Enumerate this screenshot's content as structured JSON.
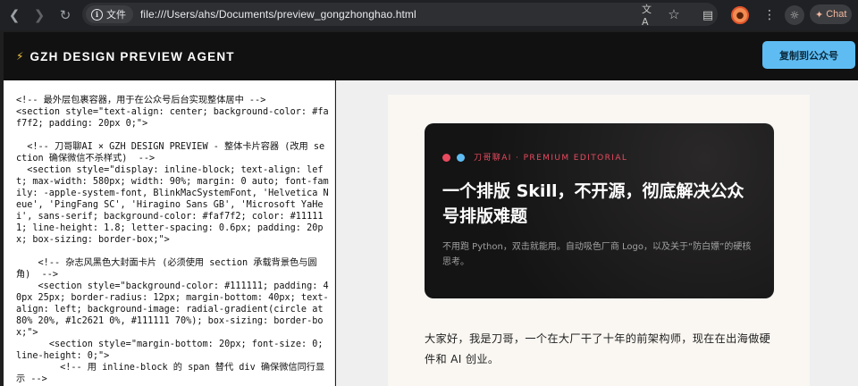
{
  "browser": {
    "file_chip_label": "文件",
    "url": "file:///Users/ahs/Documents/preview_gongzhonghao.html",
    "chat_label": "Chat",
    "icons": [
      "back-icon",
      "forward-icon",
      "reload-icon",
      "info-icon",
      "translate-icon",
      "star-icon",
      "extensions-icon",
      "avatar",
      "menu-icon",
      "bulb-icon",
      "sparkle-icon"
    ]
  },
  "header": {
    "title": "GZH DESIGN PREVIEW AGENT",
    "copy_button": "复制到公众号",
    "accent_color": "#5ebcf2"
  },
  "code": {
    "text": "<!-- 最外层包裹容器，用于在公众号后台实现整体居中 -->\n<section style=\"text-align: center; background-color: #faf7f2; padding: 20px 0;\">\n\n  <!-- 刀哥聊AI × GZH DESIGN PREVIEW - 整体卡片容器 (改用 section 确保微信不杀样式)  -->\n  <section style=\"display: inline-block; text-align: left; max-width: 580px; width: 90%; margin: 0 auto; font-family: -apple-system-font, BlinkMacSystemFont, 'Helvetica Neue', 'PingFang SC', 'Hiragino Sans GB', 'Microsoft YaHei', sans-serif; background-color: #faf7f2; color: #111111; line-height: 1.8; letter-spacing: 0.6px; padding: 20px; box-sizing: border-box;\">\n\n    <!-- 杂志风黑色大封面卡片 (必须使用 section 承载背景色与圆角)  -->\n    <section style=\"background-color: #111111; padding: 40px 25px; border-radius: 12px; margin-bottom: 40px; text-align: left; background-image: radial-gradient(circle at 80% 20%, #1c2621 0%, #111111 70%); box-sizing: border-box;\">\n      <section style=\"margin-bottom: 20px; font-size: 0; line-height: 0;\">\n        <!-- 用 inline-block 的 span 替代 div 确保微信同行显示 -->"
  },
  "preview": {
    "kicker": "刀哥聊AI · PREMIUM EDITORIAL",
    "title": "一个排版 Skill，不开源，彻底解决公众号排版难题",
    "description": "不用跑 Python，双击就能用。自动吸色厂商 Logo，以及关于“防白嫖”的硬核思考。",
    "body": "大家好，我是刀哥，一个在大厂干了十年的前架构师，现在在出海做硬件和 AI 创业。",
    "dot_colors": [
      "#e84a5f",
      "#5ebcf2"
    ]
  }
}
